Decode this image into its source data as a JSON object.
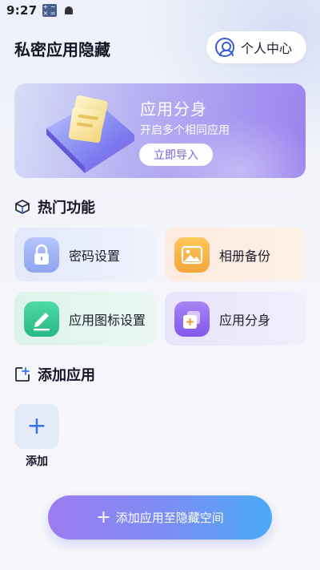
{
  "status_bar": {
    "time": "9:27",
    "icons": [
      "calculator-icon",
      "android-icon"
    ]
  },
  "header": {
    "title": "私密应用隐藏",
    "profile_label": "个人中心",
    "profile_icon": "user-circle-icon"
  },
  "banner": {
    "title": "应用分身",
    "subtitle": "开启多个相同应用",
    "button_label": "立即导入"
  },
  "hot_features": {
    "title": "热门功能",
    "icon": "cube-icon",
    "items": [
      {
        "label": "密码设置",
        "icon": "lock-icon",
        "accent": "#9fb3f3"
      },
      {
        "label": "相册备份",
        "icon": "photo-icon",
        "accent": "#f5b24a"
      },
      {
        "label": "应用图标设置",
        "icon": "edit-icon",
        "accent": "#3ec99a"
      },
      {
        "label": "应用分身",
        "icon": "clone-icon",
        "accent": "#9a6cf0"
      }
    ]
  },
  "add_section": {
    "title": "添加应用",
    "icon": "add-app-icon",
    "tile_label": "添加"
  },
  "main_button": {
    "label": "添加应用至隐藏空间"
  },
  "colors": {
    "brand_purple": "#9d7bf0",
    "brand_blue": "#4aaaf6",
    "link_blue": "#3773e6"
  }
}
